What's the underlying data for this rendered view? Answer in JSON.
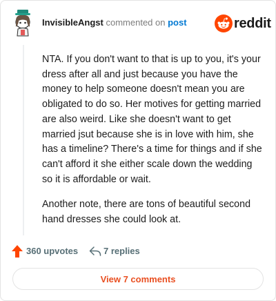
{
  "comment": {
    "author": "InvisibleAngst",
    "action_text": "commented on",
    "post_link_label": "post",
    "paragraphs": [
      "NTA. If you don't want to that is up to you, it's your dress after all and just because you have the money to help someone doesn't mean you are obligated to do so. Her motives for getting married are also weird. Like she doesn't want to get married jsut because she is in love with him, she has a timeline? There's a time for things and if she can't afford it she either scale down the wedding so it is affordable or wait.",
      "Another note, there are tons of beautiful second hand dresses she could look at."
    ]
  },
  "brand": {
    "wordmark": "reddit",
    "color": "#ff4500"
  },
  "actions": {
    "upvotes_label": "360 upvotes",
    "replies_label": "7 replies",
    "view_comments_label": "View 7 comments"
  },
  "colors": {
    "accent": "#ff4500",
    "link": "#0079d3",
    "muted": "#576f76",
    "button_text": "#e94f21"
  },
  "icons": {
    "avatar": "snoo-avatar-icon",
    "logo": "reddit-logo-icon",
    "upvote": "upvote-arrow-icon",
    "reply": "reply-arrow-icon"
  }
}
